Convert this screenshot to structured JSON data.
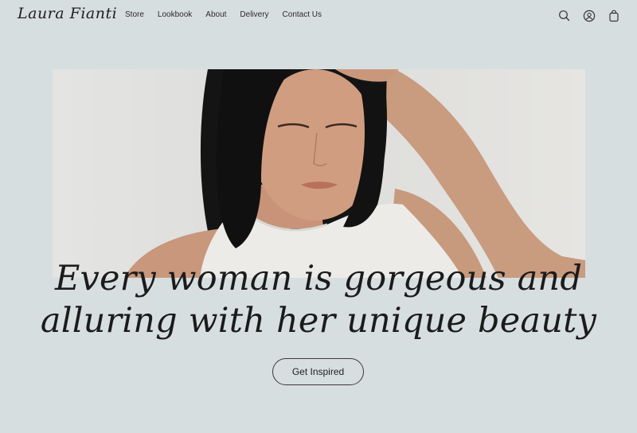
{
  "header": {
    "logo": "Laura Fianti",
    "nav": [
      {
        "label": "Store"
      },
      {
        "label": "Lookbook"
      },
      {
        "label": "About"
      },
      {
        "label": "Delivery"
      },
      {
        "label": "Contact Us"
      }
    ],
    "icons": [
      "search-icon",
      "account-icon",
      "bag-icon"
    ]
  },
  "hero": {
    "image": "portrait-woman-white-tank-top",
    "headline_line1": "Every woman is gorgeous and",
    "headline_line2": "alluring with her unique beauty",
    "cta_label": "Get Inspired"
  },
  "colors": {
    "background": "#d6dee0",
    "text": "#1b1b1b",
    "button_border": "#3a3a3a"
  }
}
